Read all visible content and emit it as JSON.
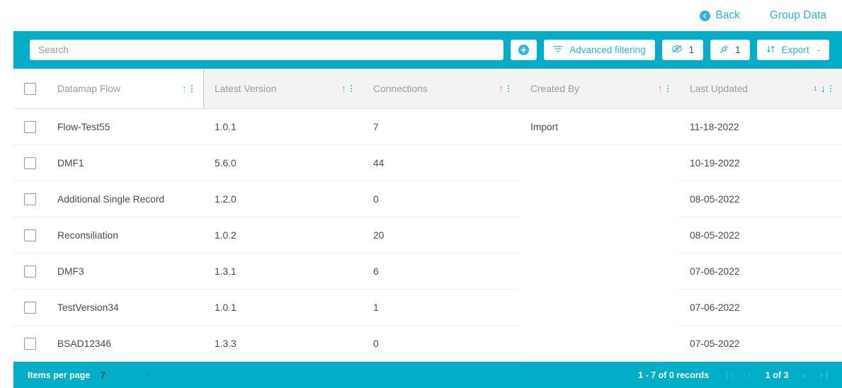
{
  "header": {
    "back_label": "Back",
    "group_data_label": "Group Data"
  },
  "toolbar": {
    "search_placeholder": "Search",
    "search_value": "",
    "add_label": "",
    "advanced_filtering_label": "Advanced filtering",
    "hidden_columns_count": "1",
    "pinned_columns_count": "1",
    "export_label": "Export",
    "export_caret": "-"
  },
  "table": {
    "columns": [
      {
        "label": "Datamap Flow",
        "sort": "asc",
        "sort_index": ""
      },
      {
        "label": "Latest Version",
        "sort": "asc",
        "sort_index": ""
      },
      {
        "label": "Connections",
        "sort": "asc",
        "sort_index": ""
      },
      {
        "label": "Created By",
        "sort": "asc",
        "sort_index": ""
      },
      {
        "label": "Last Updated",
        "sort": "desc",
        "sort_index": "1"
      }
    ],
    "rows": [
      {
        "flow": "Flow-Test55",
        "version": "1.0.1",
        "connections": "7",
        "created_by": "Import",
        "last_updated": "11-18-2022"
      },
      {
        "flow": "DMF1",
        "version": "5.6.0",
        "connections": "44",
        "created_by": "",
        "last_updated": "10-19-2022"
      },
      {
        "flow": "Additional Single Record",
        "version": "1.2.0",
        "connections": "0",
        "created_by": "",
        "last_updated": "08-05-2022"
      },
      {
        "flow": "Reconsiliation",
        "version": "1.0.2",
        "connections": "20",
        "created_by": "",
        "last_updated": "08-05-2022"
      },
      {
        "flow": "DMF3",
        "version": "1.3.1",
        "connections": "6",
        "created_by": "",
        "last_updated": "07-06-2022"
      },
      {
        "flow": "TestVersion34",
        "version": "1.0.1",
        "connections": "1",
        "created_by": "",
        "last_updated": "07-06-2022"
      },
      {
        "flow": "BSAD12346",
        "version": "1.3.3",
        "connections": "0",
        "created_by": "",
        "last_updated": "07-05-2022"
      }
    ]
  },
  "footer": {
    "items_per_page_label": "Items per page",
    "items_per_page_value": "7",
    "items_per_page_caret": "▾",
    "records_label": "1 - 7 of 0 records",
    "first_page_icon": "❘‹",
    "prev_page_icon": "‹",
    "page_position": "1 of 3",
    "next_page_icon": "›",
    "last_page_icon": "›❘"
  },
  "colors": {
    "accent_teal": "#00aec7",
    "link_blue": "#2ab6d9"
  }
}
